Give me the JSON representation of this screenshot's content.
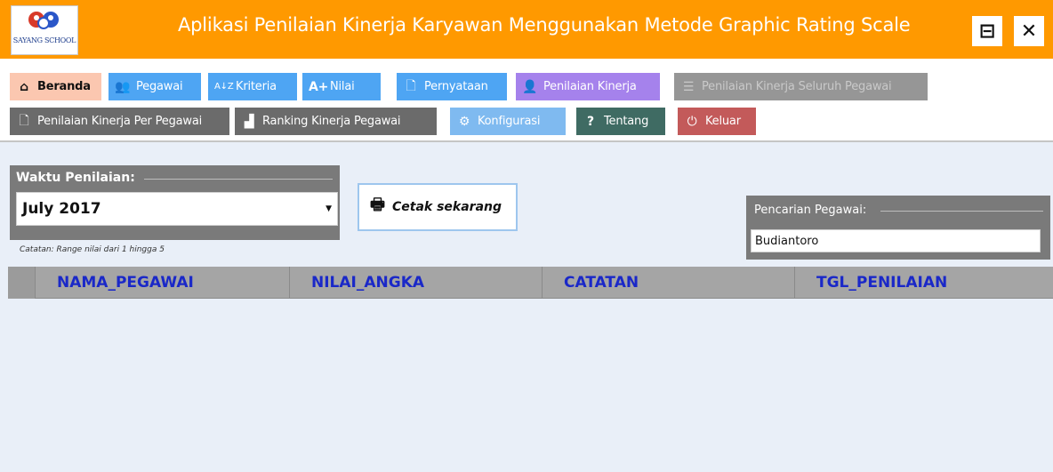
{
  "header": {
    "title": "Aplikasi Penilaian Kinerja Karyawan Menggunakan Metode Graphic Rating Scale",
    "logo_text": "SAYANG SCHOOL",
    "minimize_icon": "minimize-icon",
    "close_icon": "close-icon"
  },
  "toolbar": {
    "beranda": {
      "label": "Beranda",
      "icon": "home-icon"
    },
    "pegawai": {
      "label": "Pegawai",
      "icon": "users-icon"
    },
    "kriteria": {
      "label": "Kriteria",
      "icon": "sort-az-icon"
    },
    "nilai": {
      "label": "Nilai",
      "icon": "grade-icon"
    },
    "pernyataan": {
      "label": "Pernyataan",
      "icon": "document-icon"
    },
    "penilaian_kinerja": {
      "label": "Penilaian Kinerja",
      "icon": "user-evaluate-icon"
    },
    "penilaian_seluruh": {
      "label": "Penilaian Kinerja Seluruh Pegawai",
      "icon": "report-icon"
    },
    "penilaian_per_pegawai": {
      "label": "Penilaian Kinerja Per Pegawai",
      "icon": "document-icon"
    },
    "ranking": {
      "label": "Ranking Kinerja Pegawai",
      "icon": "ranking-icon"
    },
    "konfigurasi": {
      "label": "Konfigurasi",
      "icon": "gear-icon"
    },
    "tentang": {
      "label": "Tentang",
      "icon": "question-icon"
    },
    "keluar": {
      "label": "Keluar",
      "icon": "power-icon"
    }
  },
  "filter": {
    "waktu_label": "Waktu Penilaian:",
    "waktu_value": "July 2017",
    "note": "Catatan: Range nilai dari 1 hingga 5",
    "print_label": "Cetak sekarang",
    "search_label": "Pencarian Pegawai:",
    "search_value": "Budiantoro"
  },
  "table": {
    "columns": [
      "NAMA_PEGAWAI",
      "NILAI_ANGKA",
      "CATATAN",
      "TGL_PENILAIAN"
    ],
    "rows": []
  },
  "colors": {
    "titlebar": "#ff9900",
    "beranda": "#fbc7b0",
    "blue_button": "#4ea5f3",
    "penilaian_kinerja": "#a582ec",
    "disabled": "#969696",
    "dark_button": "#6b6b6b",
    "tentang": "#3f6b63",
    "keluar": "#c35a5a",
    "header_text": "#1a28c8"
  }
}
